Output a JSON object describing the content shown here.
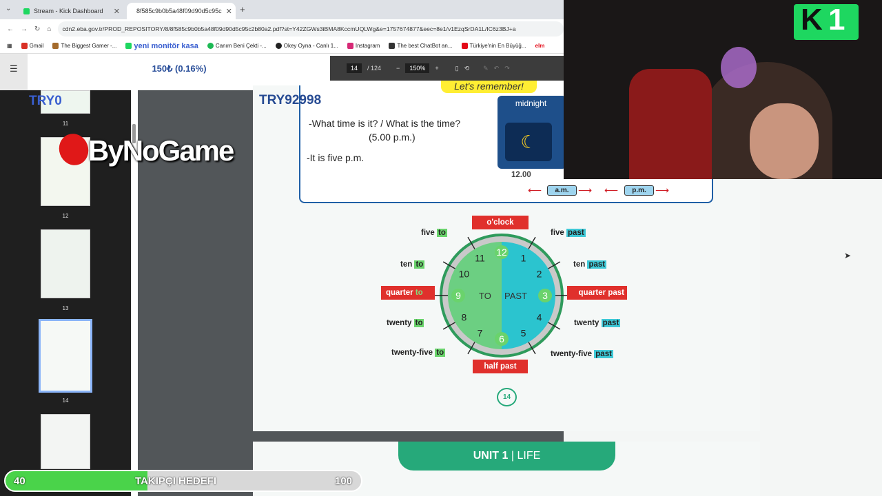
{
  "browser": {
    "tabs": [
      {
        "title": "Stream - Kick Dashboard"
      },
      {
        "title": "8f585c9b0b5a48f09d90d5c95c"
      }
    ],
    "url": "cdn2.eba.gov.tr/PROD_REPOSITORY/8/8f585c9b0b5a48f09d90d5c95c2b80a2.pdf?st=Y42ZGWs3iBMA8KccmUQLWg&e=1757674877&eec=8e1/v1EzqSrDA1L/IC6z3BJ+a",
    "bookmarks": [
      "Gmail",
      "The Biggest Gamer -...",
      "yeni monitör kasa",
      "Canım Beni Çekti -...",
      "Okey Oyna - Canlı 1...",
      "Instagram",
      "The best ChatBot an...",
      "Türkiye'nin En Büyüğ...",
      "elm"
    ]
  },
  "pdf": {
    "page": "14",
    "total": "/ 124",
    "zoom": "150%",
    "thumbs": [
      "11",
      "12",
      "13",
      "14"
    ]
  },
  "overlay": {
    "money": "150₺ (0.16%)",
    "try_left": "TRY0",
    "try_main": "TRY92998",
    "brand": "ByNoGame",
    "kick_num": "1",
    "goal": {
      "title": "TAKIPÇI HEDEFI",
      "current": "40",
      "target": "100",
      "fraction": 0.4
    }
  },
  "content": {
    "remember_title": "Let's remember!",
    "q": "-What time is it? / What is the time?",
    "q_time": "(5.00 p.m.)",
    "a": "-It is five p.m.",
    "midnight": "midnight",
    "noon": "12.00",
    "am": "a.m.",
    "pm": "p.m.",
    "oclock": "o'clock",
    "half_past": "half past",
    "to_word": "TO",
    "past_word": "PAST",
    "left_labels": [
      {
        "pre": "five",
        "hl": "to"
      },
      {
        "pre": "ten",
        "hl": "to"
      },
      {
        "pre": "quarter",
        "hl": "to"
      },
      {
        "pre": "twenty",
        "hl": "to"
      },
      {
        "pre": "twenty-five",
        "hl": "to"
      }
    ],
    "right_labels": [
      {
        "pre": "five",
        "hl": "past"
      },
      {
        "pre": "ten",
        "hl": "past"
      },
      {
        "pre": "quarter",
        "hl": "past"
      },
      {
        "pre": "twenty",
        "hl": "past"
      },
      {
        "pre": "twenty-five",
        "hl": "past"
      }
    ],
    "numbers": [
      "12",
      "1",
      "2",
      "3",
      "4",
      "5",
      "6",
      "7",
      "8",
      "9",
      "10",
      "11"
    ],
    "page_number": "14",
    "unit": "UNIT 1",
    "unit_sep": "|",
    "unit_name": "LIFE"
  },
  "colors": {
    "to": "#6ad36c",
    "past": "#3ec8d6",
    "red": "#e0302c",
    "navy": "#1e4f8a"
  }
}
